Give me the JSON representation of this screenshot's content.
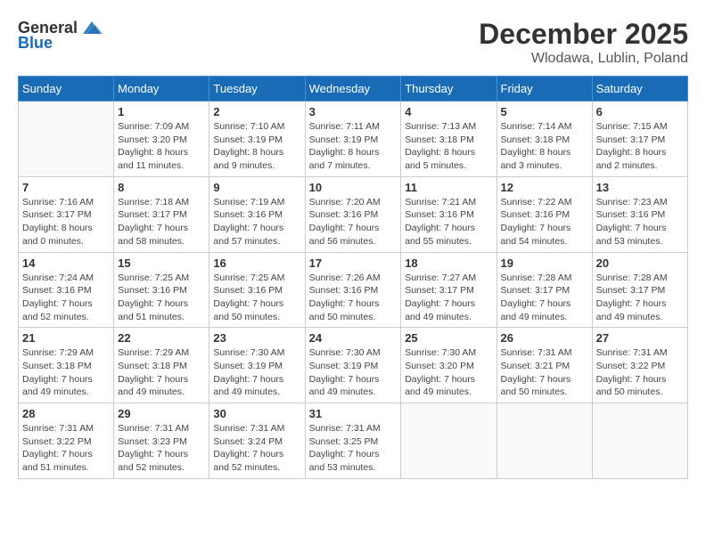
{
  "header": {
    "logo_general": "General",
    "logo_blue": "Blue",
    "month": "December 2025",
    "location": "Wlodawa, Lublin, Poland"
  },
  "days_of_week": [
    "Sunday",
    "Monday",
    "Tuesday",
    "Wednesday",
    "Thursday",
    "Friday",
    "Saturday"
  ],
  "weeks": [
    [
      {
        "day": "",
        "info": ""
      },
      {
        "day": "1",
        "info": "Sunrise: 7:09 AM\nSunset: 3:20 PM\nDaylight: 8 hours\nand 11 minutes."
      },
      {
        "day": "2",
        "info": "Sunrise: 7:10 AM\nSunset: 3:19 PM\nDaylight: 8 hours\nand 9 minutes."
      },
      {
        "day": "3",
        "info": "Sunrise: 7:11 AM\nSunset: 3:19 PM\nDaylight: 8 hours\nand 7 minutes."
      },
      {
        "day": "4",
        "info": "Sunrise: 7:13 AM\nSunset: 3:18 PM\nDaylight: 8 hours\nand 5 minutes."
      },
      {
        "day": "5",
        "info": "Sunrise: 7:14 AM\nSunset: 3:18 PM\nDaylight: 8 hours\nand 3 minutes."
      },
      {
        "day": "6",
        "info": "Sunrise: 7:15 AM\nSunset: 3:17 PM\nDaylight: 8 hours\nand 2 minutes."
      }
    ],
    [
      {
        "day": "7",
        "info": "Sunrise: 7:16 AM\nSunset: 3:17 PM\nDaylight: 8 hours\nand 0 minutes."
      },
      {
        "day": "8",
        "info": "Sunrise: 7:18 AM\nSunset: 3:17 PM\nDaylight: 7 hours\nand 58 minutes."
      },
      {
        "day": "9",
        "info": "Sunrise: 7:19 AM\nSunset: 3:16 PM\nDaylight: 7 hours\nand 57 minutes."
      },
      {
        "day": "10",
        "info": "Sunrise: 7:20 AM\nSunset: 3:16 PM\nDaylight: 7 hours\nand 56 minutes."
      },
      {
        "day": "11",
        "info": "Sunrise: 7:21 AM\nSunset: 3:16 PM\nDaylight: 7 hours\nand 55 minutes."
      },
      {
        "day": "12",
        "info": "Sunrise: 7:22 AM\nSunset: 3:16 PM\nDaylight: 7 hours\nand 54 minutes."
      },
      {
        "day": "13",
        "info": "Sunrise: 7:23 AM\nSunset: 3:16 PM\nDaylight: 7 hours\nand 53 minutes."
      }
    ],
    [
      {
        "day": "14",
        "info": "Sunrise: 7:24 AM\nSunset: 3:16 PM\nDaylight: 7 hours\nand 52 minutes."
      },
      {
        "day": "15",
        "info": "Sunrise: 7:25 AM\nSunset: 3:16 PM\nDaylight: 7 hours\nand 51 minutes."
      },
      {
        "day": "16",
        "info": "Sunrise: 7:25 AM\nSunset: 3:16 PM\nDaylight: 7 hours\nand 50 minutes."
      },
      {
        "day": "17",
        "info": "Sunrise: 7:26 AM\nSunset: 3:16 PM\nDaylight: 7 hours\nand 50 minutes."
      },
      {
        "day": "18",
        "info": "Sunrise: 7:27 AM\nSunset: 3:17 PM\nDaylight: 7 hours\nand 49 minutes."
      },
      {
        "day": "19",
        "info": "Sunrise: 7:28 AM\nSunset: 3:17 PM\nDaylight: 7 hours\nand 49 minutes."
      },
      {
        "day": "20",
        "info": "Sunrise: 7:28 AM\nSunset: 3:17 PM\nDaylight: 7 hours\nand 49 minutes."
      }
    ],
    [
      {
        "day": "21",
        "info": "Sunrise: 7:29 AM\nSunset: 3:18 PM\nDaylight: 7 hours\nand 49 minutes."
      },
      {
        "day": "22",
        "info": "Sunrise: 7:29 AM\nSunset: 3:18 PM\nDaylight: 7 hours\nand 49 minutes."
      },
      {
        "day": "23",
        "info": "Sunrise: 7:30 AM\nSunset: 3:19 PM\nDaylight: 7 hours\nand 49 minutes."
      },
      {
        "day": "24",
        "info": "Sunrise: 7:30 AM\nSunset: 3:19 PM\nDaylight: 7 hours\nand 49 minutes."
      },
      {
        "day": "25",
        "info": "Sunrise: 7:30 AM\nSunset: 3:20 PM\nDaylight: 7 hours\nand 49 minutes."
      },
      {
        "day": "26",
        "info": "Sunrise: 7:31 AM\nSunset: 3:21 PM\nDaylight: 7 hours\nand 50 minutes."
      },
      {
        "day": "27",
        "info": "Sunrise: 7:31 AM\nSunset: 3:22 PM\nDaylight: 7 hours\nand 50 minutes."
      }
    ],
    [
      {
        "day": "28",
        "info": "Sunrise: 7:31 AM\nSunset: 3:22 PM\nDaylight: 7 hours\nand 51 minutes."
      },
      {
        "day": "29",
        "info": "Sunrise: 7:31 AM\nSunset: 3:23 PM\nDaylight: 7 hours\nand 52 minutes."
      },
      {
        "day": "30",
        "info": "Sunrise: 7:31 AM\nSunset: 3:24 PM\nDaylight: 7 hours\nand 52 minutes."
      },
      {
        "day": "31",
        "info": "Sunrise: 7:31 AM\nSunset: 3:25 PM\nDaylight: 7 hours\nand 53 minutes."
      },
      {
        "day": "",
        "info": ""
      },
      {
        "day": "",
        "info": ""
      },
      {
        "day": "",
        "info": ""
      }
    ]
  ]
}
